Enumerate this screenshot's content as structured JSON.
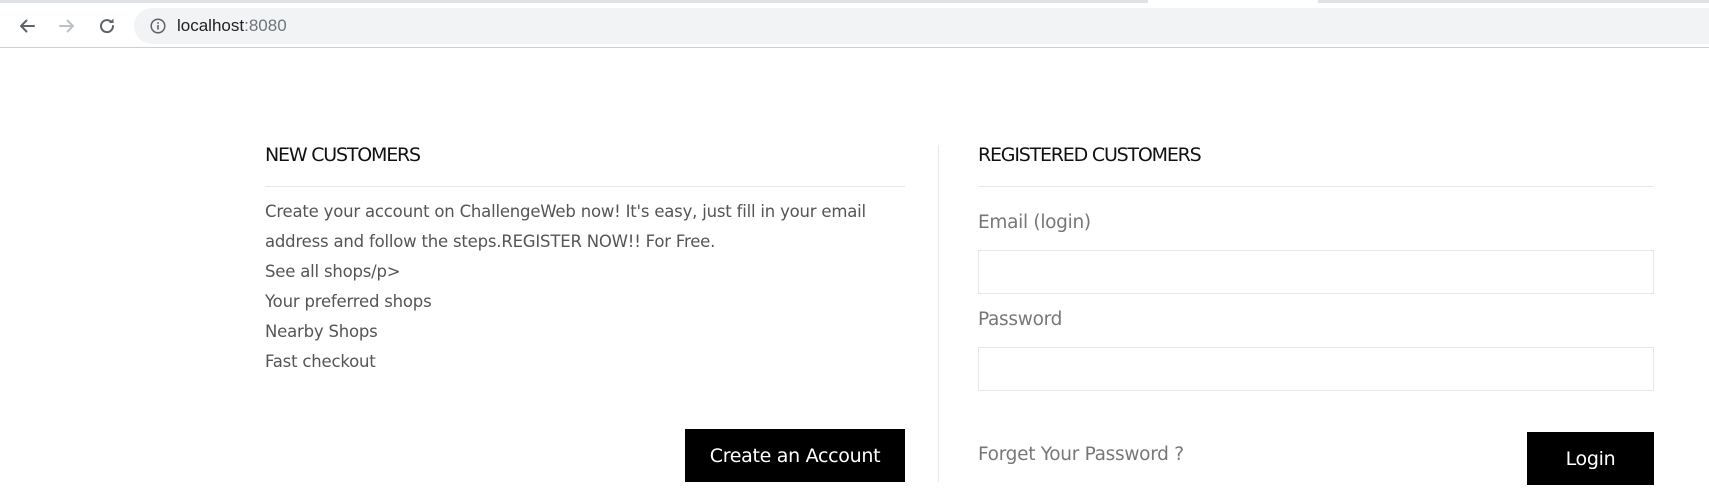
{
  "browser": {
    "url_host": "localhost",
    "url_port": ":8080",
    "icons": {
      "back": "arrow-left-icon",
      "forward": "arrow-right-icon",
      "reload": "reload-icon",
      "site_info": "info-circle-icon"
    }
  },
  "new_customers": {
    "title": "NEW CUSTOMERS",
    "intro_line1": "Create your account on ChallengeWeb now! It's easy, just fill in your email",
    "intro_line2": "address and follow the steps.REGISTER NOW!! For Free.",
    "links": [
      "See all shops/p>",
      "Your preferred shops",
      "Nearby Shops",
      "Fast checkout"
    ],
    "create_button": "Create an Account"
  },
  "registered_customers": {
    "title": "REGISTERED CUSTOMERS",
    "email_label": "Email (login)",
    "email_value": "",
    "password_label": "Password",
    "password_value": "",
    "forgot_link": "Forget Your Password ?",
    "login_button": "Login"
  },
  "colors": {
    "button_bg": "#000000",
    "button_text": "#ffffff",
    "body_text": "#555555",
    "label_text": "#777777"
  }
}
